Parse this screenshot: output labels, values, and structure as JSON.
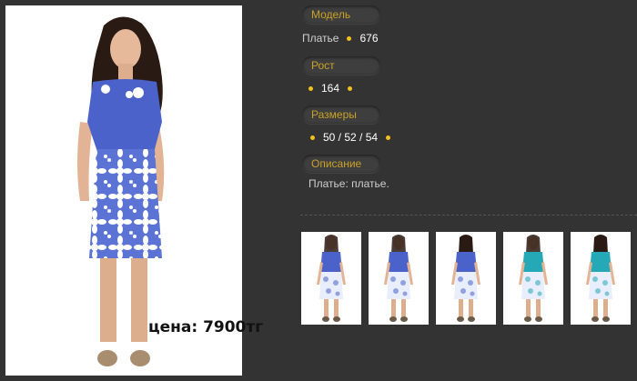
{
  "price": "цена: 7900тг",
  "fields": {
    "model": {
      "label": "Модель",
      "prefix": "Платье",
      "value": "676"
    },
    "height": {
      "label": "Рост",
      "value": "164"
    },
    "sizes": {
      "label": "Размеры",
      "value": "50 / 52 / 54"
    },
    "description": {
      "label": "Описание",
      "value": "Платье: платье."
    }
  },
  "thumbnails": [
    {
      "view": "front",
      "dress": "blue-top-white-floral-skirt"
    },
    {
      "view": "front",
      "dress": "blue-top-white-floral-skirt"
    },
    {
      "view": "back",
      "dress": "blue-top-white-floral-skirt"
    },
    {
      "view": "front",
      "dress": "turquoise-top-white-floral-skirt"
    },
    {
      "view": "back",
      "dress": "turquoise-top-white-floral-skirt"
    }
  ],
  "colors": {
    "label_text": "#c9a227",
    "bullet": "#f2c21a",
    "background": "#333333",
    "dress_blue": "#4a62c9",
    "dress_turquoise": "#25a9b7"
  }
}
